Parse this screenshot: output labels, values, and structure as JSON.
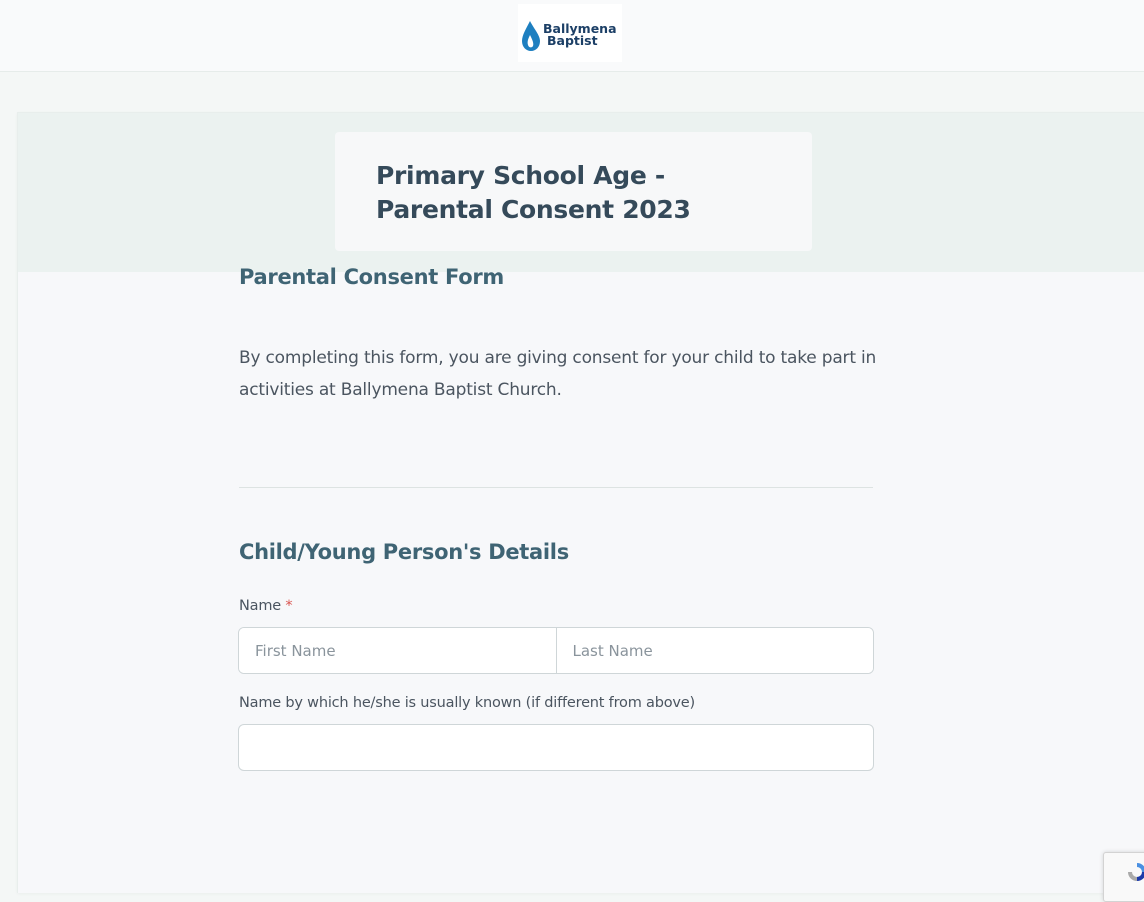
{
  "header": {
    "logo_line1": "Ballymena",
    "logo_line2": "Baptist",
    "logo_color": "#1e7fc0"
  },
  "form": {
    "title_line1": "Primary School Age -",
    "title_line2": "Parental Consent 2023",
    "section1_heading": "Parental Consent Form",
    "intro_text": "By completing this form, you are giving consent for your child to take part in activities at Ballymena Baptist Church.",
    "section2_heading": "Child/Young Person's Details",
    "name_label": "Name",
    "required_marker": "*",
    "first_name_placeholder": "First Name",
    "last_name_placeholder": "Last Name",
    "known_as_label": "Name by which he/she is usually known (if different from above)",
    "known_as_value": ""
  },
  "colors": {
    "accent_heading": "#3f6474",
    "title": "#354a5a",
    "required": "#d9534f",
    "header_band": "#ebf2f0"
  },
  "icons": {
    "logo": "flame-drop-icon",
    "recaptcha": "recaptcha-icon"
  }
}
